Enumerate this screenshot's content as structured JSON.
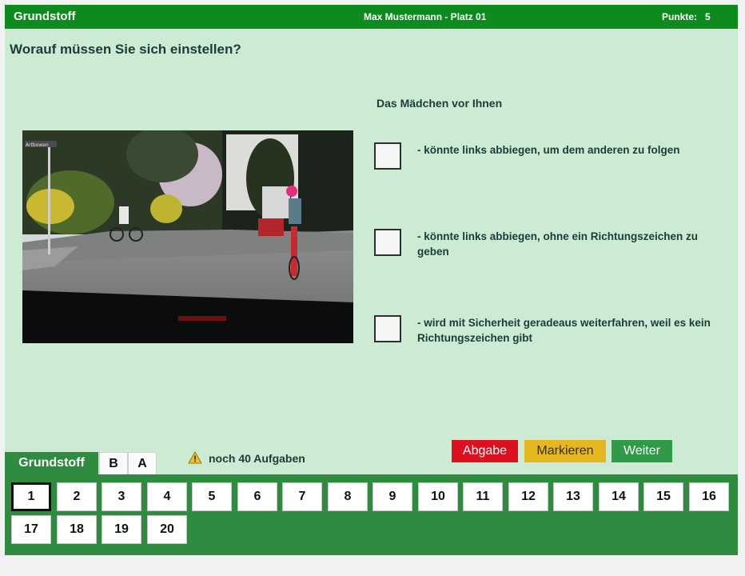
{
  "header": {
    "title": "Grundstoff",
    "candidate": "Max Mustermann - Platz 01",
    "points_label": "Punkte:",
    "points_value": "5"
  },
  "question": {
    "text": "Worauf müssen Sie sich einstellen?",
    "subtitle": "Das Mädchen vor Ihnen",
    "image_sign_text": "Artbowen",
    "answers": [
      {
        "text": "- könnte links abbiegen, um dem anderen zu folgen",
        "checked": false
      },
      {
        "text": "- könnte links abbiegen, ohne ein Richtungszeichen zu geben",
        "checked": false
      },
      {
        "text": "- wird mit Sicherheit geradeaus weiterfahren, weil es kein Richtungszeichen gibt",
        "checked": false
      }
    ]
  },
  "actions": {
    "submit": "Abgabe",
    "mark": "Markieren",
    "next": "Weiter"
  },
  "tabs": [
    "Grundstoff",
    "B",
    "A"
  ],
  "status": {
    "remaining": "noch 40 Aufgaben",
    "icon": "warning-icon"
  },
  "questions_nav": {
    "numbers": [
      "1",
      "2",
      "3",
      "4",
      "5",
      "6",
      "7",
      "8",
      "9",
      "10",
      "11",
      "12",
      "13",
      "14",
      "15",
      "16",
      "17",
      "18",
      "19",
      "20"
    ],
    "current": "1"
  },
  "colors": {
    "header_green": "#0e8a1e",
    "background": "#cdebd3",
    "panel_green": "#2e8b40",
    "abgabe_red": "#dd1020",
    "markieren_yellow": "#e6b820",
    "weiter_green": "#2f9a47"
  }
}
